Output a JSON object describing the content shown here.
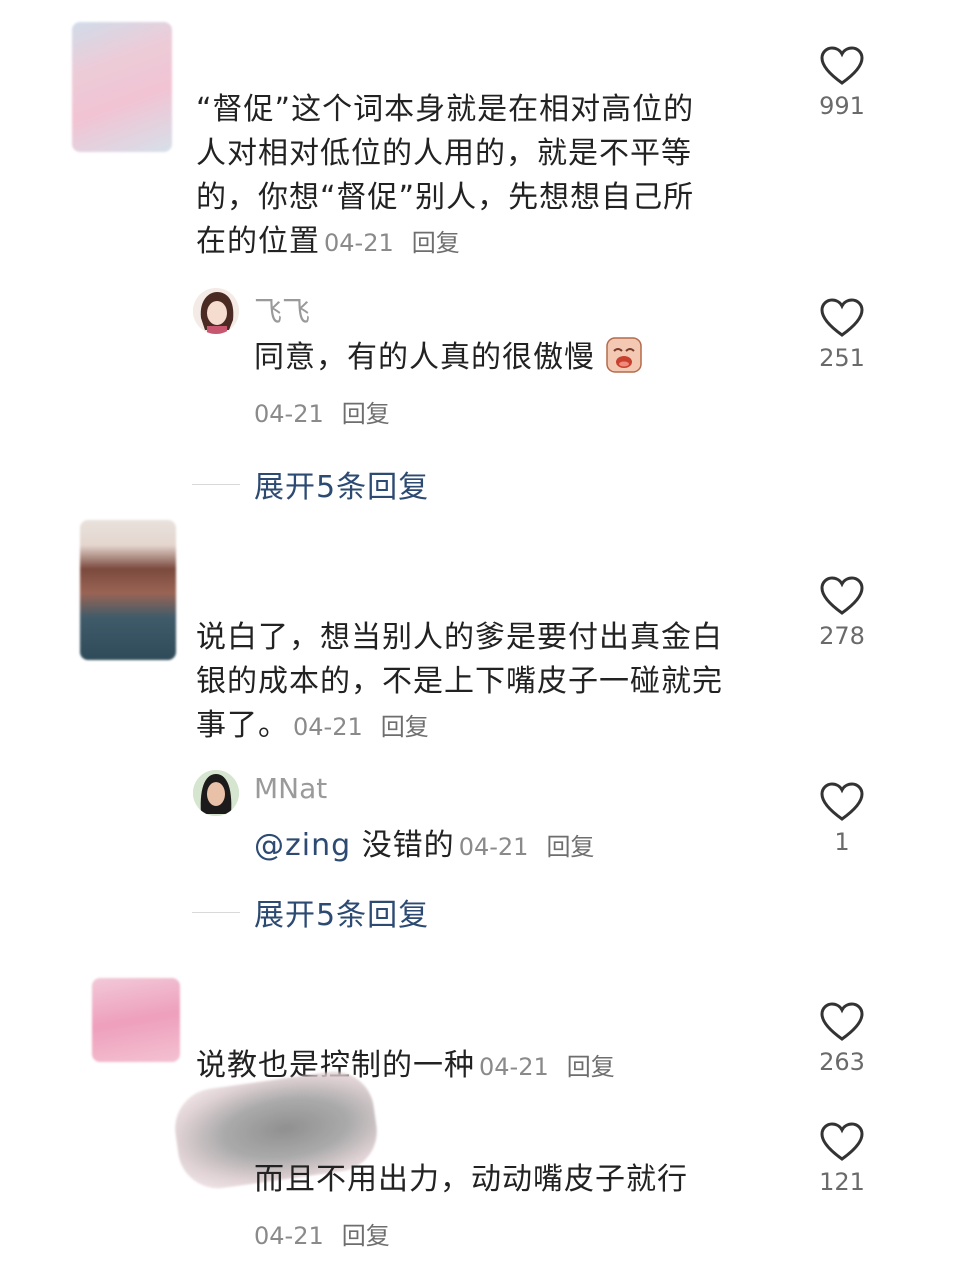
{
  "comments": [
    {
      "text_lines": [
        "“督促”这个词本身就是在相对高位的",
        "人对相对低位的人用的，就是不平等",
        "的，你想“督促”别人，先想想自己所",
        "在的位置"
      ],
      "date": "04-21",
      "reply_label": "回复",
      "likes": "991",
      "reply": {
        "username": "飞飞",
        "text": "同意，有的人真的很傲慢",
        "date": "04-21",
        "reply_label": "回复",
        "likes": "251"
      },
      "expand_label": "展开5条回复"
    },
    {
      "text_lines": [
        "说白了，想当别人的爹是要付出真金白",
        "银的成本的，不是上下嘴皮子一碰就完",
        "事了。"
      ],
      "date": "04-21",
      "reply_label": "回复",
      "likes": "278",
      "reply": {
        "username": "MNat",
        "mention": "@zing",
        "text": "没错的",
        "date": "04-21",
        "reply_label": "回复",
        "likes": "1"
      },
      "expand_label": "展开5条回复"
    },
    {
      "text_lines": [
        "说教也是控制的一种"
      ],
      "date": "04-21",
      "reply_label": "回复",
      "likes": "263",
      "reply": {
        "text": "而且不用出力，动动嘴皮子就行",
        "date": "04-21",
        "reply_label": "回复",
        "likes": "121"
      }
    }
  ],
  "icons": {
    "like": "heart-outline-icon",
    "emoji": "crying-face-icon"
  },
  "colors": {
    "link": "#2c4a72",
    "meta": "#8a8a8a",
    "text": "#222222"
  }
}
